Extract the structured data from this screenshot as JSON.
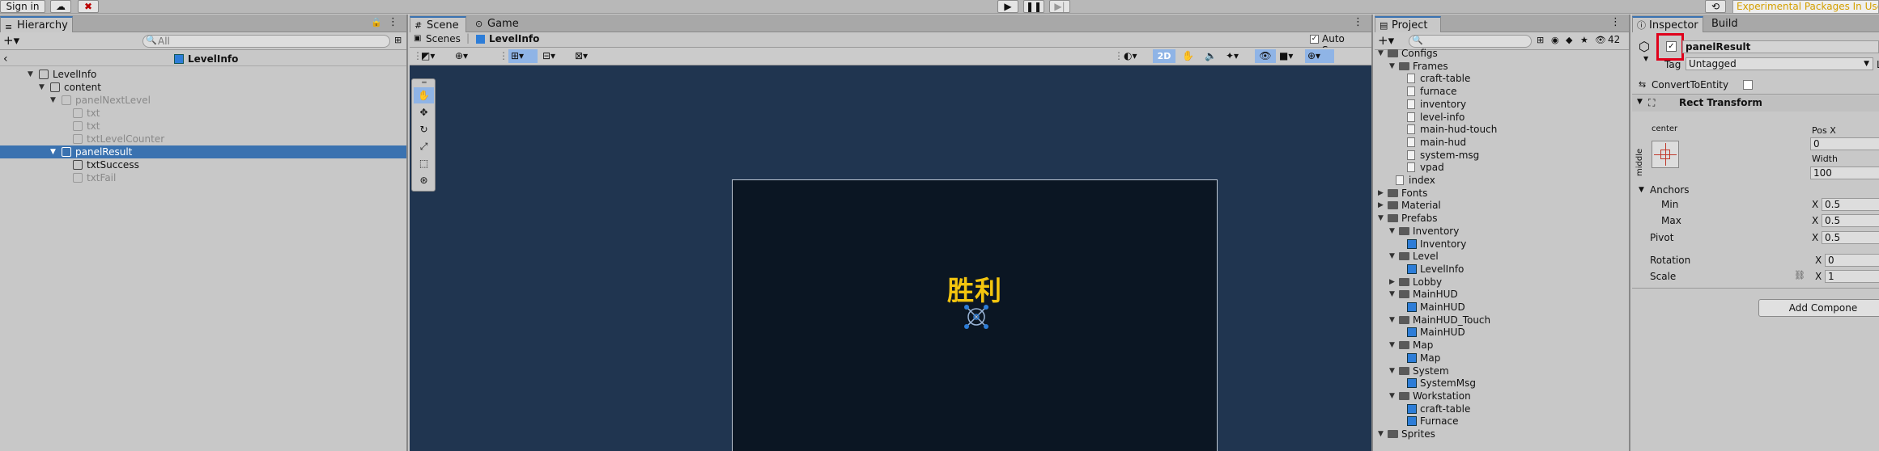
{
  "topbar": {
    "sign_in": "Sign in",
    "experimental": "Experimental Packages In Use"
  },
  "hierarchy": {
    "tab": "Hierarchy",
    "search_placeholder": "All",
    "scene_title": "LevelInfo",
    "items": [
      {
        "label": "LevelInfo",
        "depth": 0,
        "state": "normal"
      },
      {
        "label": "content",
        "depth": 1,
        "state": "normal"
      },
      {
        "label": "panelNextLevel",
        "depth": 2,
        "state": "disabled"
      },
      {
        "label": "txt",
        "depth": 3,
        "state": "disabled"
      },
      {
        "label": "txt",
        "depth": 3,
        "state": "disabled"
      },
      {
        "label": "txtLevelCounter",
        "depth": 3,
        "state": "disabled"
      },
      {
        "label": "panelResult",
        "depth": 2,
        "state": "selected"
      },
      {
        "label": "txtSuccess",
        "depth": 3,
        "state": "normal"
      },
      {
        "label": "txtFail",
        "depth": 3,
        "state": "disabled"
      }
    ]
  },
  "scene": {
    "tab_scene": "Scene",
    "tab_game": "Game",
    "breadcrumb_root": "Scenes",
    "breadcrumb_item": "LevelInfo",
    "auto_save": "Auto Save",
    "mode_2d": "2D",
    "canvas_text": "胜利"
  },
  "project": {
    "tab": "Project",
    "hidden_count": "42",
    "items": [
      {
        "label": "Configs",
        "depth": 1,
        "kind": "folder",
        "open": true
      },
      {
        "label": "Frames",
        "depth": 2,
        "kind": "folder",
        "open": true
      },
      {
        "label": "craft-table",
        "depth": 3,
        "kind": "file"
      },
      {
        "label": "furnace",
        "depth": 3,
        "kind": "file"
      },
      {
        "label": "inventory",
        "depth": 3,
        "kind": "file"
      },
      {
        "label": "level-info",
        "depth": 3,
        "kind": "file"
      },
      {
        "label": "main-hud-touch",
        "depth": 3,
        "kind": "file"
      },
      {
        "label": "main-hud",
        "depth": 3,
        "kind": "file"
      },
      {
        "label": "system-msg",
        "depth": 3,
        "kind": "file"
      },
      {
        "label": "vpad",
        "depth": 3,
        "kind": "file"
      },
      {
        "label": "index",
        "depth": 2,
        "kind": "file"
      },
      {
        "label": "Fonts",
        "depth": 1,
        "kind": "folder",
        "open": false
      },
      {
        "label": "Material",
        "depth": 1,
        "kind": "folder",
        "open": false
      },
      {
        "label": "Prefabs",
        "depth": 1,
        "kind": "folder",
        "open": true
      },
      {
        "label": "Inventory",
        "depth": 2,
        "kind": "folder",
        "open": true
      },
      {
        "label": "Inventory",
        "depth": 3,
        "kind": "prefab"
      },
      {
        "label": "Level",
        "depth": 2,
        "kind": "folder",
        "open": true
      },
      {
        "label": "LevelInfo",
        "depth": 3,
        "kind": "prefab"
      },
      {
        "label": "Lobby",
        "depth": 2,
        "kind": "folder",
        "open": false
      },
      {
        "label": "MainHUD",
        "depth": 2,
        "kind": "folder",
        "open": true
      },
      {
        "label": "MainHUD",
        "depth": 3,
        "kind": "prefab"
      },
      {
        "label": "MainHUD_Touch",
        "depth": 2,
        "kind": "folder",
        "open": true
      },
      {
        "label": "MainHUD",
        "depth": 3,
        "kind": "prefab"
      },
      {
        "label": "Map",
        "depth": 2,
        "kind": "folder",
        "open": true
      },
      {
        "label": "Map",
        "depth": 3,
        "kind": "prefab"
      },
      {
        "label": "System",
        "depth": 2,
        "kind": "folder",
        "open": true
      },
      {
        "label": "SystemMsg",
        "depth": 3,
        "kind": "prefab"
      },
      {
        "label": "Workstation",
        "depth": 2,
        "kind": "folder",
        "open": true
      },
      {
        "label": "craft-table",
        "depth": 3,
        "kind": "prefab"
      },
      {
        "label": "Furnace",
        "depth": 3,
        "kind": "prefab"
      },
      {
        "label": "Sprites",
        "depth": 1,
        "kind": "folder",
        "open": true
      }
    ]
  },
  "inspector": {
    "tab_inspector": "Inspector",
    "tab_build": "Build",
    "object_name": "panelResult",
    "tag_label": "Tag",
    "tag_value": "Untagged",
    "layer_label": "La",
    "convert_label": "ConvertToEntity",
    "rect_transform": "Rect Transform",
    "anchor_h": "center",
    "anchor_v": "middle",
    "pos_x_label": "Pos X",
    "pos_x": "0",
    "width_label": "Width",
    "width": "100",
    "anchors": "Anchors",
    "min": "Min",
    "max": "Max",
    "x": "X",
    "min_x": "0.5",
    "max_x": "0.5",
    "pivot": "Pivot",
    "pivot_x": "0.5",
    "rotation": "Rotation",
    "rotation_x": "0",
    "scale": "Scale",
    "scale_x": "1",
    "add_component": "Add Compone"
  },
  "colors": {
    "selection": "#3a72b0",
    "scene_bg": "#203550",
    "canvas_bg": "#0b1623",
    "victory": "#f2c40f",
    "highlight": "#e0001a"
  }
}
